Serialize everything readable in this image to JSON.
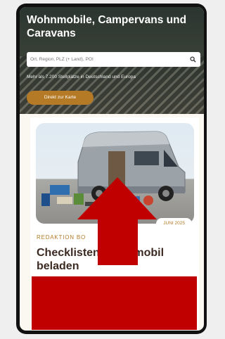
{
  "hero": {
    "title": "Wohnmobile, Campervans und Caravans",
    "search_placeholder": "Ort, Region, PLZ (+ Land), POI",
    "subtitle": "Mehr als 7.200 Stellplätze in Deutschland und Europa",
    "map_button_label": "Direkt zur Karte"
  },
  "article": {
    "category": "REDAKTION BO",
    "date": "JUNI 2025",
    "title": "Checklisten Wohnmobil beladen"
  },
  "icons": {
    "search": "search-icon",
    "arrow": "up-arrow-icon"
  },
  "colors": {
    "accent": "#b57a26",
    "title_dark": "#3b2a22",
    "overlay_red": "#c00000"
  }
}
